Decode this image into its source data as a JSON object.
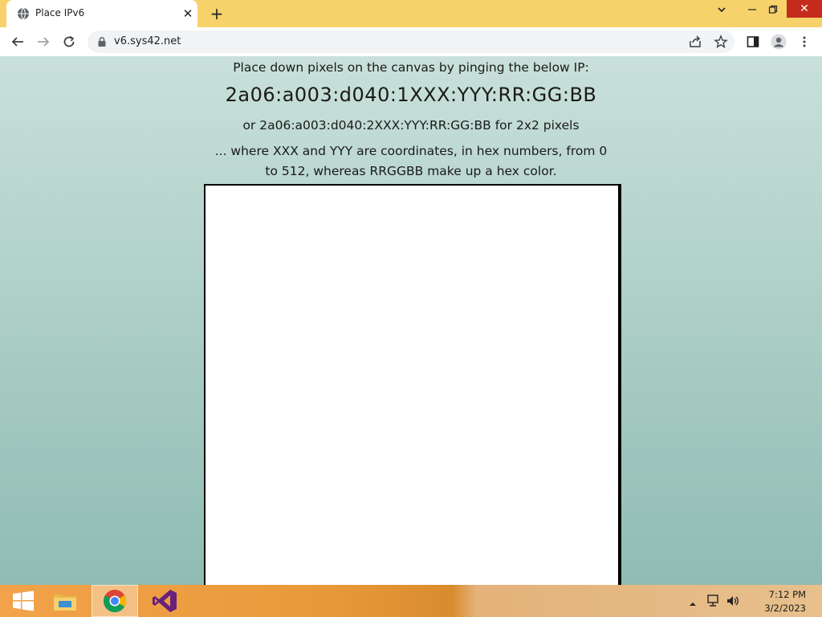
{
  "browser": {
    "tab": {
      "title": "Place IPv6",
      "favicon": "globe-icon"
    },
    "address_bar": {
      "url": "v6.sys42.net"
    },
    "toolbar_icons": [
      "back-icon",
      "forward-icon",
      "reload-icon",
      "share-icon",
      "bookmark-star-icon",
      "side-panel-icon",
      "profile-icon",
      "menu-dots-icon"
    ],
    "window_controls": [
      "tab-search-chevron-icon",
      "minimize-icon",
      "restore-icon",
      "close-icon"
    ]
  },
  "page": {
    "intro": "Place down pixels on the canvas by pinging the below IP:",
    "ip_format": "2a06:a003:d040:1XXX:YYY:RR:GG:BB",
    "alt_format": "or 2a06:a003:d040:2XXX:YYY:RR:GG:BB for 2x2 pixels",
    "description": "... where XXX and YYY are coordinates, in hex numbers, from 0 to 512, whereas RRGGBB make up a hex color.",
    "background_top": "#c9e0da",
    "background_bottom": "#8fbcb3"
  },
  "taskbar": {
    "apps": [
      "windows-start-icon",
      "file-explorer-icon",
      "chrome-icon",
      "visual-studio-icon"
    ],
    "clock": {
      "time": "7:12 PM",
      "date": "3/2/2023"
    },
    "tray_icons": [
      "show-hidden-icons-icon",
      "network-icon",
      "volume-icon"
    ]
  }
}
